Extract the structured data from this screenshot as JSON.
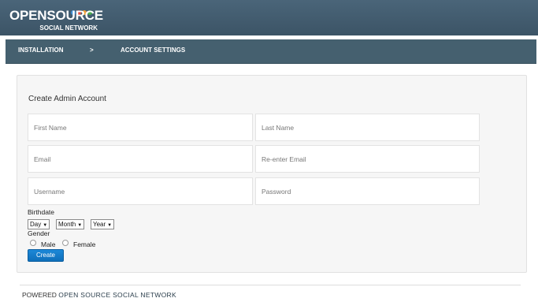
{
  "brand": {
    "name": "OPENSOURCE",
    "tagline": "SOCIAL NETWORK",
    "badge_letters": [
      "o",
      "s",
      "s",
      "n"
    ],
    "badge_colors": [
      "#3d8fd6",
      "#e84c3d",
      "#f1a33b",
      "#4caf50"
    ]
  },
  "nav": {
    "step1": "INSTALLATION",
    "separator": ">",
    "step2": "ACCOUNT SETTINGS"
  },
  "form": {
    "title": "Create Admin Account",
    "first_name_placeholder": "First Name",
    "last_name_placeholder": "Last Name",
    "email_placeholder": "Email",
    "reemail_placeholder": "Re-enter Email",
    "username_placeholder": "Username",
    "password_placeholder": "Password",
    "birthdate_label": "Birthdate",
    "day": "Day",
    "month": "Month",
    "year": "Year",
    "gender_label": "Gender",
    "male": "Male",
    "female": "Female",
    "submit": "Create"
  },
  "footer": {
    "prefix": "POWERED",
    "name": "OPEN SOURCE SOCIAL NETWORK"
  },
  "colors": {
    "header": "#45606f",
    "button": "#1a7fcf"
  }
}
